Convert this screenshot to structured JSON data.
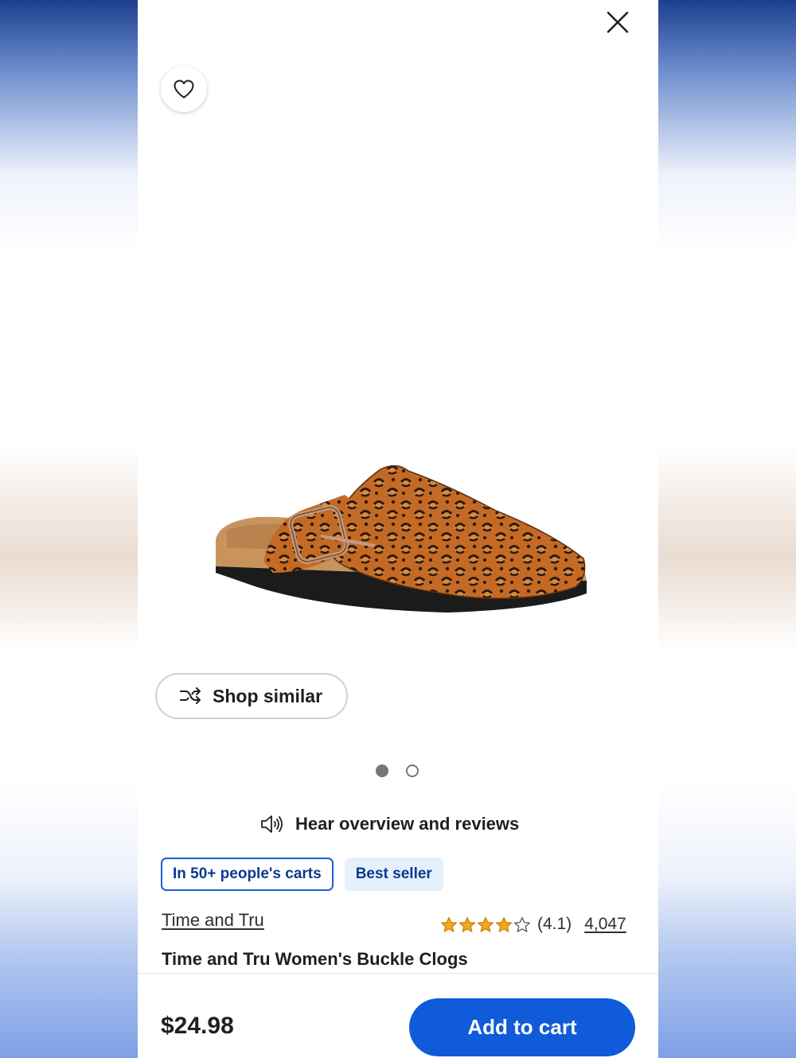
{
  "header": {
    "close_icon": "close-icon",
    "favorite_icon": "heart-icon"
  },
  "gallery": {
    "image_alt": "leopard print buckle clog",
    "shop_similar_label": "Shop similar",
    "shop_similar_icon": "shuffle-icon",
    "dots": [
      "active",
      "inactive"
    ]
  },
  "audio": {
    "icon": "speaker-icon",
    "label": "Hear overview and reviews"
  },
  "badges": {
    "in_carts": "In 50+ people's carts",
    "best_seller": "Best seller"
  },
  "product": {
    "brand": "Time and Tru",
    "rating": "(4.1)",
    "rating_value": 4.1,
    "stars_filled": 4,
    "stars_total": 5,
    "review_count": "4,047",
    "title": "Time and Tru Women's Buckle Clogs"
  },
  "footer": {
    "price": "$24.98",
    "add_to_cart": "Add to cart"
  },
  "colors": {
    "accent": "#0f5bd9",
    "badge_text": "#0d3a8f",
    "star": "#f5a623"
  }
}
